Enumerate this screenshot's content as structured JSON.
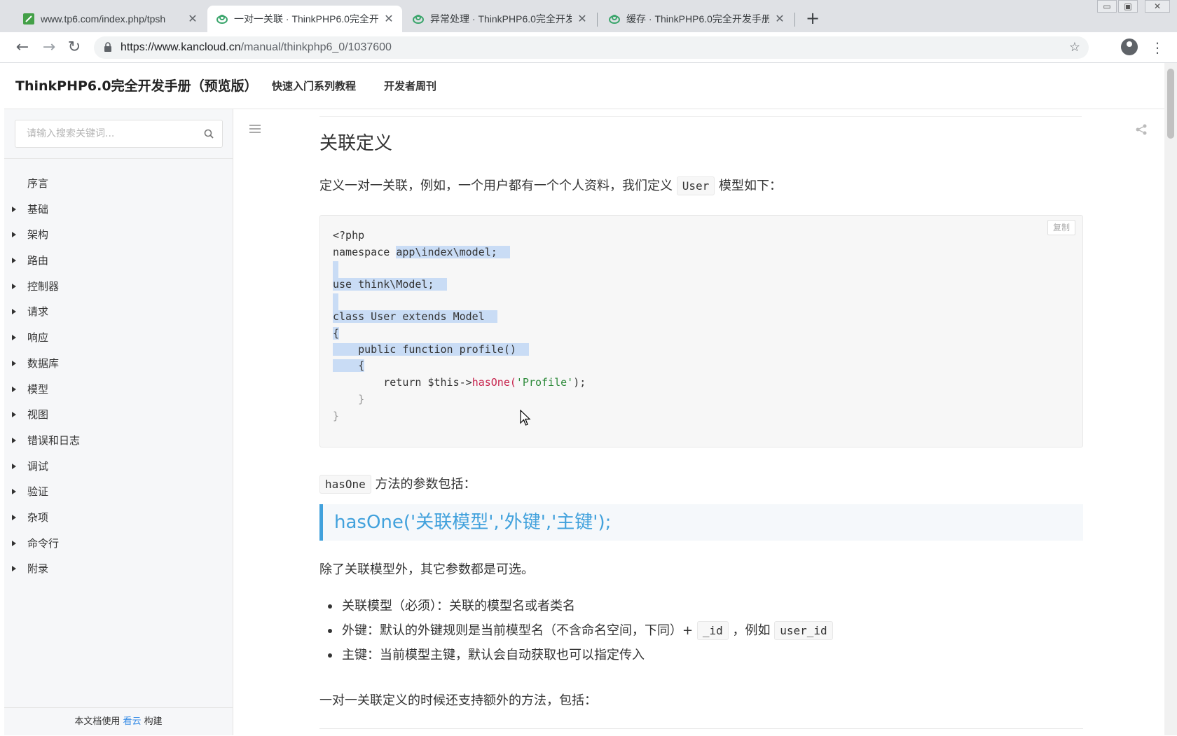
{
  "browser": {
    "tabs": [
      {
        "title": "www.tp6.com/index.php/tpsh",
        "close": "✕",
        "active": false
      },
      {
        "title": "一对一关联 · ThinkPHP6.0完全开",
        "close": "✕",
        "active": true
      },
      {
        "title": "异常处理 · ThinkPHP6.0完全开发",
        "close": "✕",
        "active": false
      },
      {
        "title": "缓存 · ThinkPHP6.0完全开发手册",
        "close": "✕",
        "active": false
      }
    ],
    "new_tab": "+",
    "url_host": "https://www.kancloud.cn",
    "url_path": "/manual/thinkphp6_0/1037600",
    "back": "←",
    "forward": "→",
    "reload": "↻",
    "bookmark": "☆",
    "menu": "⋮",
    "window_controls": {
      "minimize": "▭",
      "restore": "▣",
      "close": "✕"
    }
  },
  "header": {
    "brand": "ThinkPHP6.0完全开发手册（预览版）",
    "nav": [
      "快速入门系列教程",
      "开发者周刊"
    ]
  },
  "sidebar": {
    "search_placeholder": "请输入搜索关键词...",
    "items": [
      {
        "label": "序言",
        "expandable": false
      },
      {
        "label": "基础",
        "expandable": true
      },
      {
        "label": "架构",
        "expandable": true
      },
      {
        "label": "路由",
        "expandable": true
      },
      {
        "label": "控制器",
        "expandable": true
      },
      {
        "label": "请求",
        "expandable": true
      },
      {
        "label": "响应",
        "expandable": true
      },
      {
        "label": "数据库",
        "expandable": true
      },
      {
        "label": "模型",
        "expandable": true
      },
      {
        "label": "视图",
        "expandable": true
      },
      {
        "label": "错误和日志",
        "expandable": true
      },
      {
        "label": "调试",
        "expandable": true
      },
      {
        "label": "验证",
        "expandable": true
      },
      {
        "label": "杂项",
        "expandable": true
      },
      {
        "label": "命令行",
        "expandable": true
      },
      {
        "label": "附录",
        "expandable": true
      }
    ],
    "footer_pre": "本文档使用",
    "footer_link": "看云",
    "footer_post": "构建"
  },
  "article": {
    "heading": "关联定义",
    "intro_pre": "定义一对一关联，例如，一个用户都有一个个人资料，我们定义",
    "intro_code": "User",
    "intro_post": "模型如下：",
    "copy_label": "复制",
    "code": {
      "l1": "<?php",
      "l2a": "namespace ",
      "l2b": "app\\index\\model;",
      "l4": "use think\\Model;",
      "l6": "class User extends Model",
      "l7": "{",
      "l8": "    public function profile()",
      "l9": "    {",
      "l10a": "        return $this->",
      "l10b": "hasOne(",
      "l10c": "'Profile'",
      "l10d": ");",
      "l11": "    }",
      "l12": "}"
    },
    "params_code": "hasOne",
    "params_text": "方法的参数包括：",
    "quote": "hasOne('关联模型','外键','主键');",
    "optional_text": "除了关联模型外，其它参数都是可选。",
    "bullets": {
      "b1": "关联模型（必须）：关联的模型名或者类名",
      "b2_pre": "外键：默认的外键规则是当前模型名（不含命名空间，下同）+",
      "b2_code1": "_id",
      "b2_mid": "，例如",
      "b2_code2": "user_id",
      "b3": "主键：当前模型主键，默认会自动获取也可以指定传入"
    },
    "extra_text": "一对一关联定义的时候还支持额外的方法，包括："
  },
  "colors": {
    "accent": "#41a1dc",
    "selection": "#c9dcf5",
    "sidebar_bg": "#f6f7f9"
  }
}
